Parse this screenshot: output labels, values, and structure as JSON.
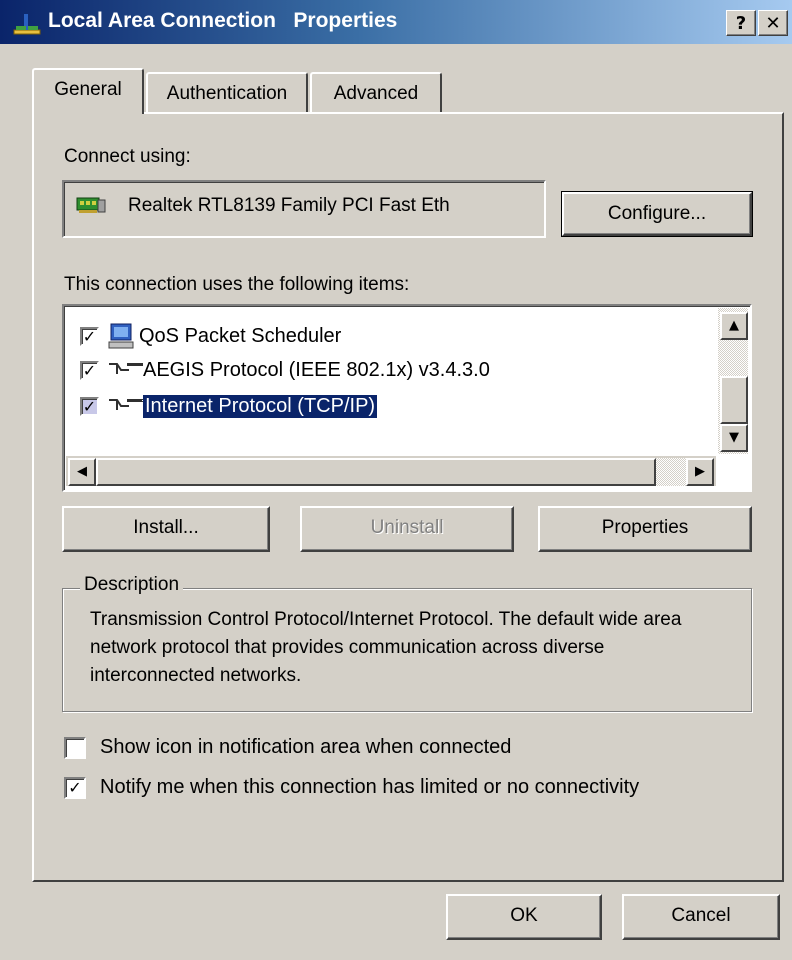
{
  "window": {
    "title": "Local Area Connection   Properties",
    "help_label": "?",
    "close_label": "✕",
    "title_gradient": [
      "#0a246a",
      "#a6caf0"
    ]
  },
  "tabs": [
    {
      "label": "General",
      "selected": true
    },
    {
      "label": "Authentication",
      "selected": false
    },
    {
      "label": "Advanced",
      "selected": false
    }
  ],
  "connect_using": {
    "label": "Connect using:",
    "adapter": "Realtek RTL8139 Family PCI Fast Eth",
    "adapter_icon": "network-card-icon",
    "configure_label": "Configure..."
  },
  "items": {
    "label": "This connection uses the following items:",
    "list": [
      {
        "label": "QoS Packet Scheduler",
        "checked": true,
        "icon": "scheduler-icon"
      },
      {
        "label": "AEGIS Protocol (IEEE 802.1x) v3.4.3.0",
        "checked": true,
        "icon": "protocol-icon"
      },
      {
        "label": "Internet Protocol (TCP/IP)",
        "checked": true,
        "icon": "protocol-icon",
        "selected": true
      }
    ]
  },
  "buttons": {
    "install": "Install...",
    "uninstall": "Uninstall",
    "properties": "Properties"
  },
  "description": {
    "legend": "Description",
    "text": "Transmission Control Protocol/Internet Protocol. The default wide area network protocol that provides communication across diverse interconnected networks."
  },
  "options": {
    "show_icon": {
      "label": "Show icon in notification area when connected",
      "checked": false
    },
    "notify": {
      "label": "Notify me when this connection has limited or no connectivity",
      "checked": true
    }
  },
  "footer": {
    "ok": "OK",
    "cancel": "Cancel"
  },
  "colors": {
    "face": "#d4d0c8",
    "selection": "#0a246a"
  }
}
